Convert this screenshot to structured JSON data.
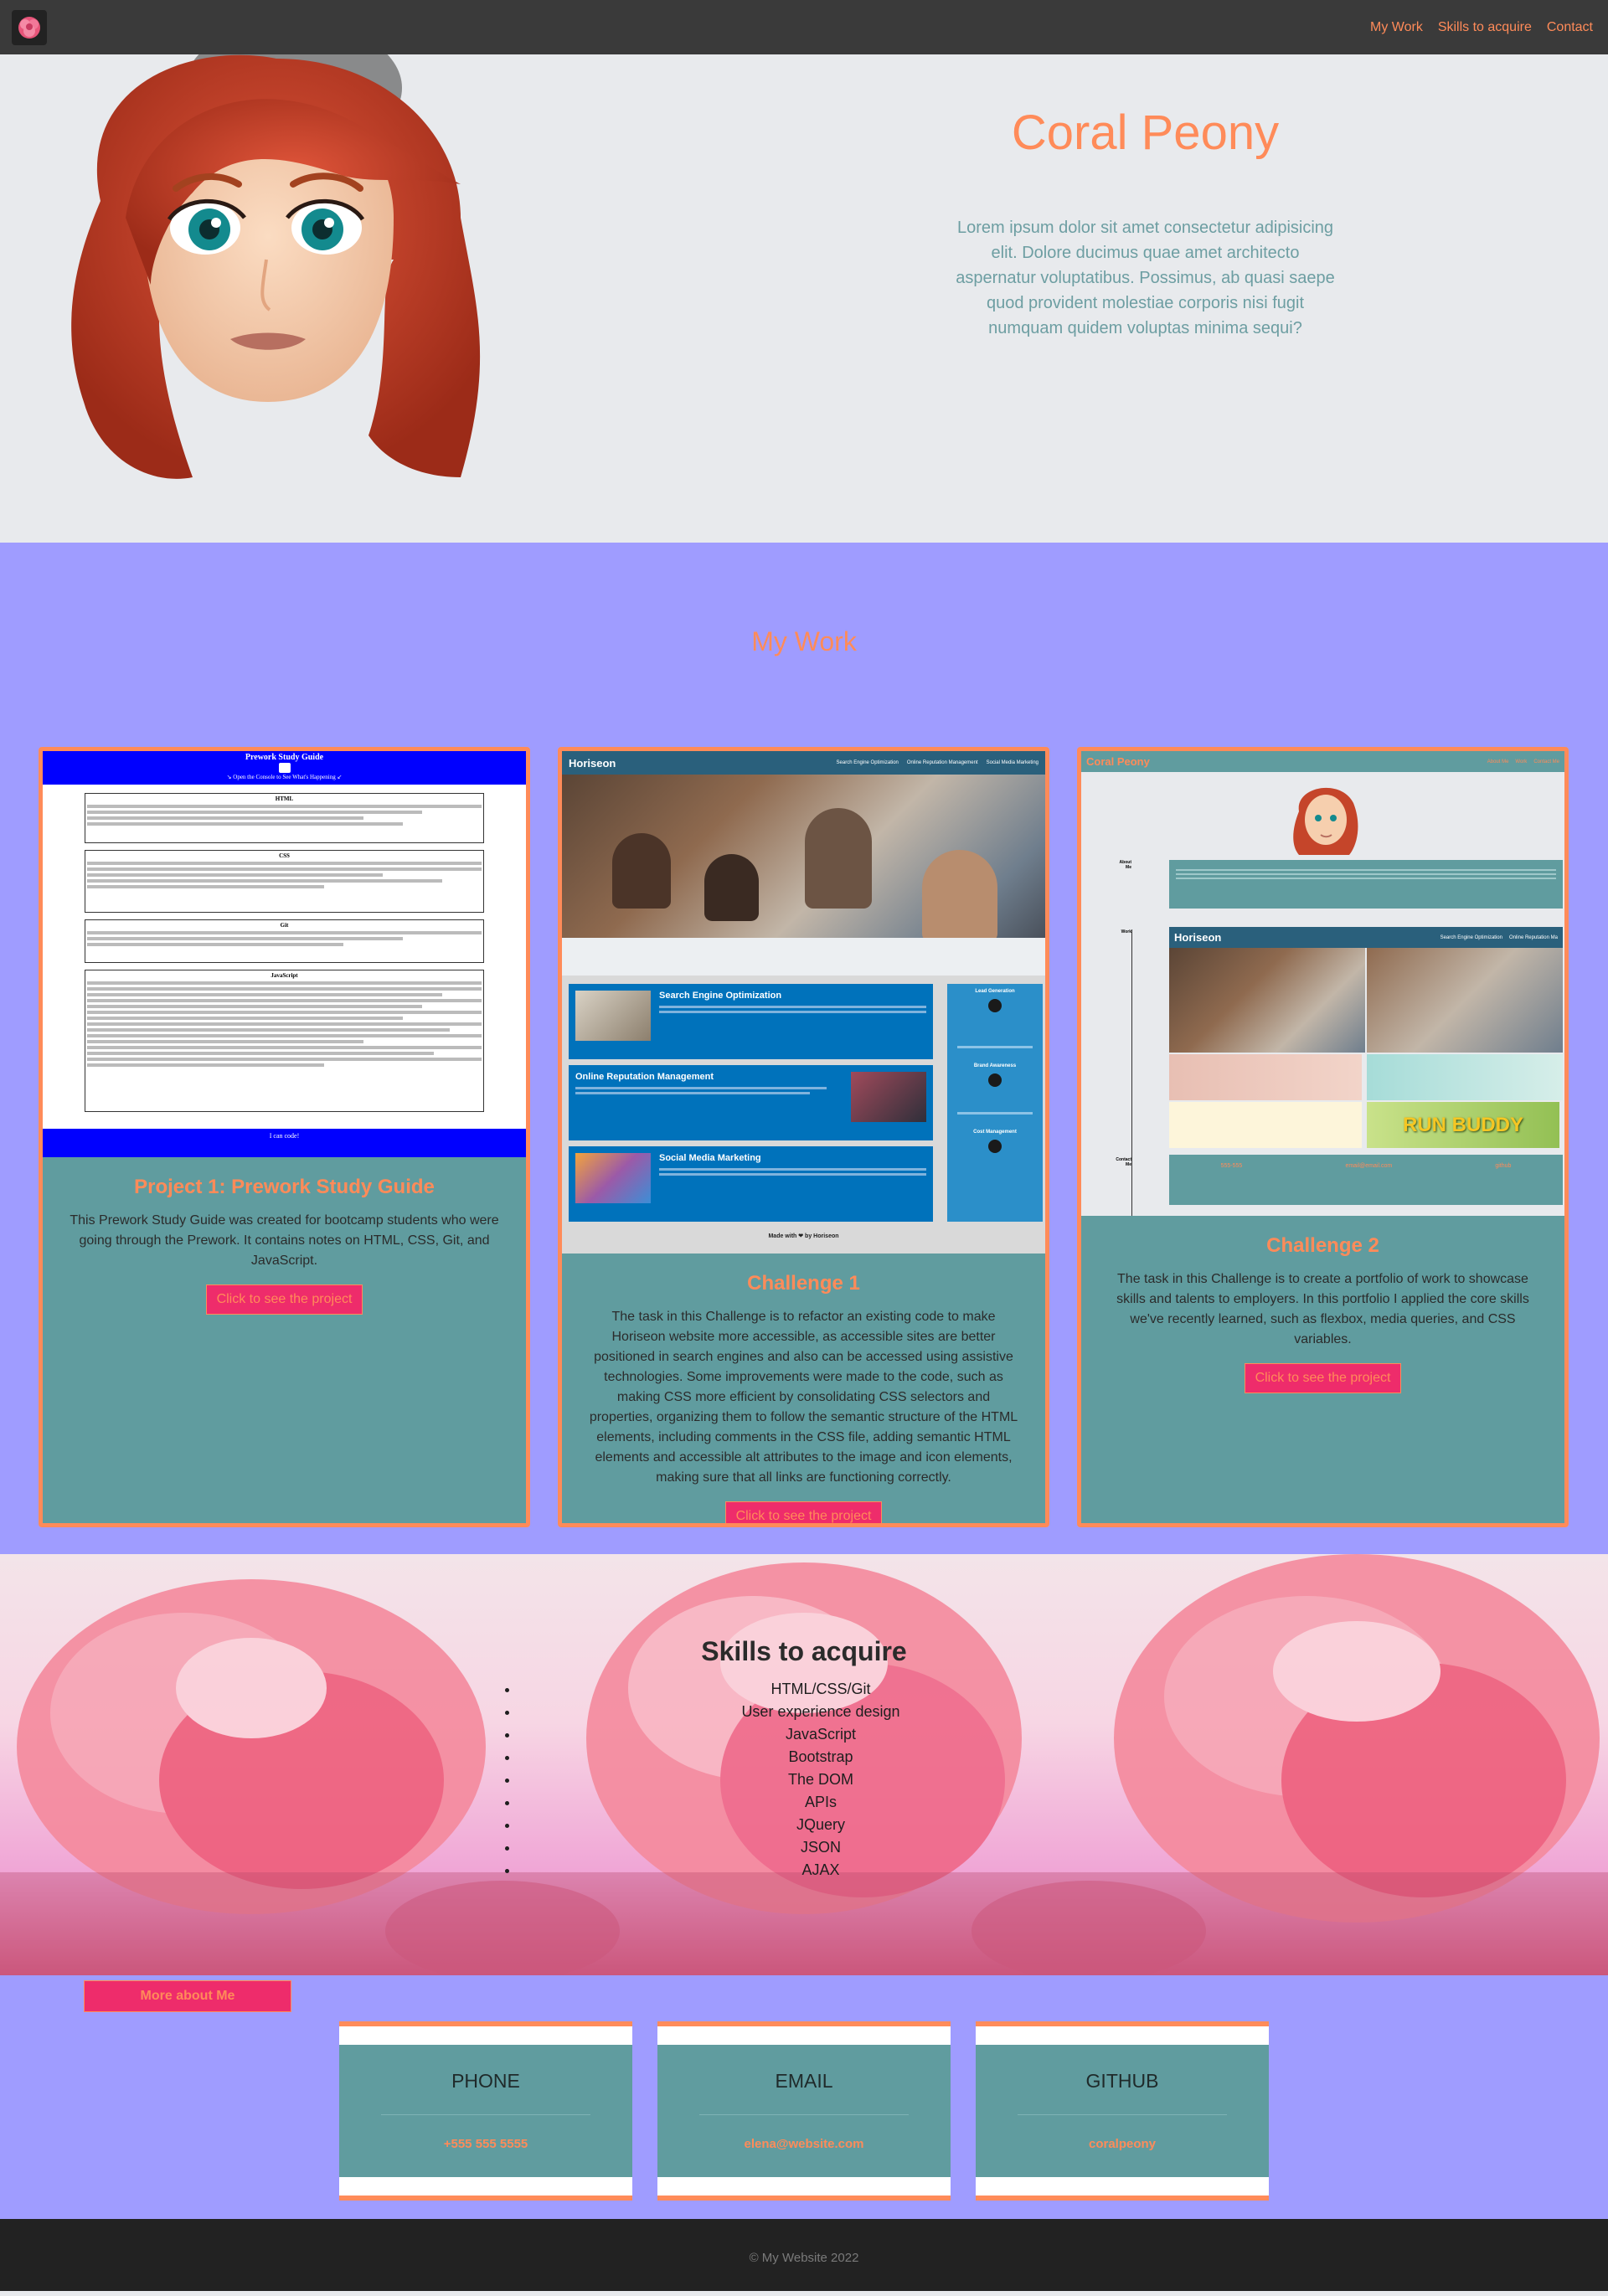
{
  "colors": {
    "accent": "#ff8b59",
    "nav_bg": "#3a3a3a",
    "section_bg": "#9f9cff",
    "card_bg": "#609c9f",
    "button_bg": "#ee2c6b",
    "footer_bg": "#222222"
  },
  "nav": {
    "logo_icon": "peony-flower-icon",
    "links": [
      "My Work",
      "Skills to acquire",
      "Contact"
    ]
  },
  "hero": {
    "title": "Coral Peony",
    "text": "Lorem ipsum dolor sit amet consectetur adipisicing elit. Dolore ducimus quae amet architecto aspernatur voluptatibus. Possimus, ab quasi saepe quod provident molestiae corporis nisi fugit numquam quidem voluptas minima sequi?"
  },
  "work": {
    "title": "My Work",
    "cards": [
      {
        "title": "Project 1: Prework Study Guide",
        "text": "This Prework Study Guide was created for bootcamp students who were going through the Prework. It contains notes on HTML, CSS, Git, and JavaScript.",
        "button": "Click to see the project",
        "shot": {
          "header": "Prework Study Guide",
          "subheader": "↘ Open the Console to See What's Happening ↙",
          "sections": [
            "HTML",
            "CSS",
            "Git",
            "JavaScript"
          ],
          "footer": "I can code!"
        }
      },
      {
        "title": "Challenge 1",
        "text": "The task in this Challenge is to refactor an existing code to make Horiseon website more accessible, as accessible sites are better positioned in search engines and also can be accessed using assistive technologies. Some improvements were made to the code, such as making CSS more efficient by consolidating CSS selectors and properties, organizing them to follow the semantic structure of the HTML elements, including comments in the CSS file, adding semantic HTML elements and accessible alt attributes to the image and icon elements, making sure that all links are functioning correctly.",
        "button": "Click to see the project",
        "shot": {
          "brand": "Horiseon",
          "nav": [
            "Search Engine Optimization",
            "Online Reputation Management",
            "Social Media Marketing"
          ],
          "blocks": [
            "Search Engine Optimization",
            "Online Reputation Management",
            "Social Media Marketing"
          ],
          "side": [
            "Lead Generation",
            "Brand Awareness",
            "Cost Management"
          ],
          "footer": "Made with ❤ by Horiseon"
        }
      },
      {
        "title": "Challenge 2",
        "text": "The task in this Challenge is to create a portfolio of work to showcase skills and talents to employers. In this portfolio I applied the core skills we've recently learned, such as flexbox, media queries, and CSS variables.",
        "button": "Click to see the project",
        "shot": {
          "brand": "Coral Peony",
          "nav": [
            "About Me",
            "Work",
            "Contact Me"
          ],
          "labels": [
            "About Me",
            "Work",
            "Contact Me"
          ],
          "inner_brand": "Horiseon",
          "inner_nav": [
            "Search Engine Optimization",
            "Online Reputation Ma"
          ],
          "tile_text": "RUN BUDDY",
          "contact_items": [
            "555-555",
            "email@email.com",
            "github"
          ]
        }
      }
    ]
  },
  "skills": {
    "title": "Skills to acquire",
    "items": [
      "HTML/CSS/Git",
      "User experience design",
      "JavaScript",
      "Bootstrap",
      "The DOM",
      "APIs",
      "JQuery",
      "JSON",
      "AJAX"
    ]
  },
  "about_button": "More about Me",
  "contacts": [
    {
      "label": "PHONE",
      "value": "+555 555 5555"
    },
    {
      "label": "EMAIL",
      "value": "elena@website.com"
    },
    {
      "label": "GITHUB",
      "value": "coralpeony"
    }
  ],
  "footer": "© My Website 2022"
}
